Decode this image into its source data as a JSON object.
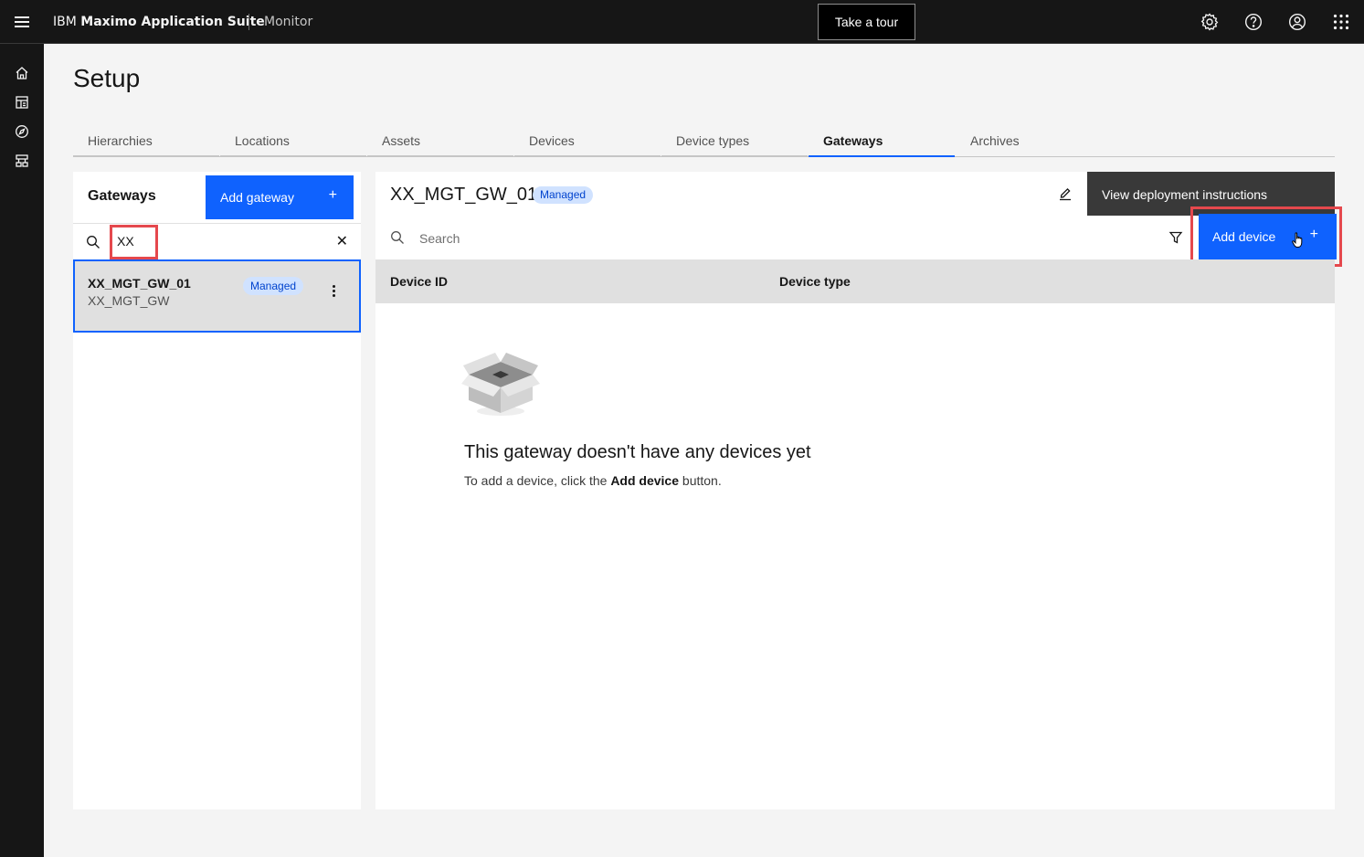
{
  "header": {
    "brand_prefix": "IBM",
    "brand_name": "Maximo Application Suite",
    "app_name": "Monitor",
    "tour_button": "Take a tour"
  },
  "page": {
    "title": "Setup"
  },
  "tabs": [
    {
      "label": "Hierarchies"
    },
    {
      "label": "Locations"
    },
    {
      "label": "Assets"
    },
    {
      "label": "Devices"
    },
    {
      "label": "Device types"
    },
    {
      "label": "Gateways",
      "active": true
    },
    {
      "label": "Archives"
    }
  ],
  "gateways_panel": {
    "title": "Gateways",
    "add_button": "Add gateway",
    "search_value": "XX",
    "items": [
      {
        "name": "XX_MGT_GW_01",
        "type": "XX_MGT_GW",
        "badge": "Managed"
      }
    ]
  },
  "detail": {
    "title": "XX_MGT_GW_01",
    "badge": "Managed",
    "deploy_button": "View deployment instructions",
    "search_placeholder": "Search",
    "add_device_button": "Add device",
    "columns": [
      "Device ID",
      "Device type"
    ],
    "empty_title": "This gateway doesn't have any devices yet",
    "empty_desc_prefix": "To add a device, click the",
    "empty_desc_bold": "Add device",
    "empty_desc_suffix": "button."
  },
  "colors": {
    "primary": "#0f62fe",
    "header_bg": "#161616",
    "highlight": "#e5484d",
    "tag_bg": "#d0e2ff"
  }
}
